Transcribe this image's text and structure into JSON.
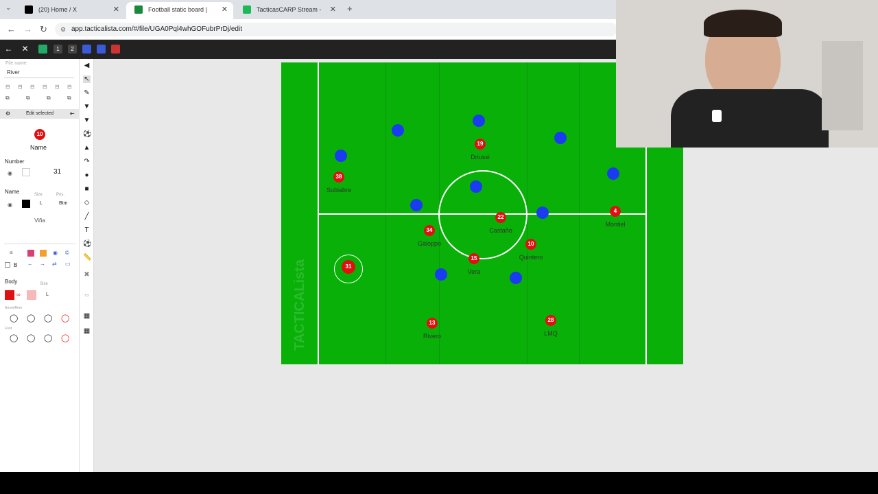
{
  "browser": {
    "tabs": [
      {
        "label": "(20) Home / X",
        "color": "#000000"
      },
      {
        "label": "Football static board | TACTICA",
        "color": "#1a8a3a"
      },
      {
        "label": "TacticasCARP Stream - Watch L",
        "color": "#1db954"
      }
    ],
    "url": "app.tacticalista.com/#/file/UGA0Pql4whGOFubrPrDj/edit"
  },
  "panel": {
    "file_label": "File name",
    "file_name": "River",
    "edit_selected": "Edit selected",
    "token_number": "10",
    "token_name_label": "Name",
    "number_section": "Number",
    "number_value": "31",
    "name_section": "Name",
    "size_hint": "Size",
    "pos_hint": "Pos.",
    "size_value": "L",
    "pos_value": "Btm",
    "name_value": "Viña",
    "body_section": "Body",
    "body_size_hint": "Size",
    "body_size_value": "L",
    "arrows_hint": "Arrow/Rem",
    "foot_hint": "Foot",
    "bold_label": "B"
  },
  "pitch": {
    "watermark": "TACTICALista",
    "blue_players": [
      {
        "x": 0.29
      },
      {
        "x": 0.49
      },
      {
        "x": 0.7
      },
      {
        "x": 0.15
      },
      {
        "x": 0.83
      },
      {
        "x": 0.48
      },
      {
        "x": 0.34
      },
      {
        "x": 0.65
      },
      {
        "x": 0.4
      },
      {
        "x": 0.59
      }
    ],
    "red_players": [
      {
        "number": "38",
        "name": "Subiabre"
      },
      {
        "number": "19",
        "name": "Driussi"
      },
      {
        "number": "4",
        "name": "Montiel"
      },
      {
        "number": "22",
        "name": "Castaño"
      },
      {
        "number": "34",
        "name": "Galoppo"
      },
      {
        "number": "10",
        "name": "Quintero"
      },
      {
        "number": "15",
        "name": "Vera"
      },
      {
        "number": "31",
        "name": ""
      },
      {
        "number": "13",
        "name": "Rivero"
      },
      {
        "number": "28",
        "name": "LMQ"
      }
    ]
  },
  "colors": {
    "pitch": "#08b008",
    "team_a": "#1a3cf0",
    "team_b": "#e01010",
    "app_bar": "#222222"
  }
}
